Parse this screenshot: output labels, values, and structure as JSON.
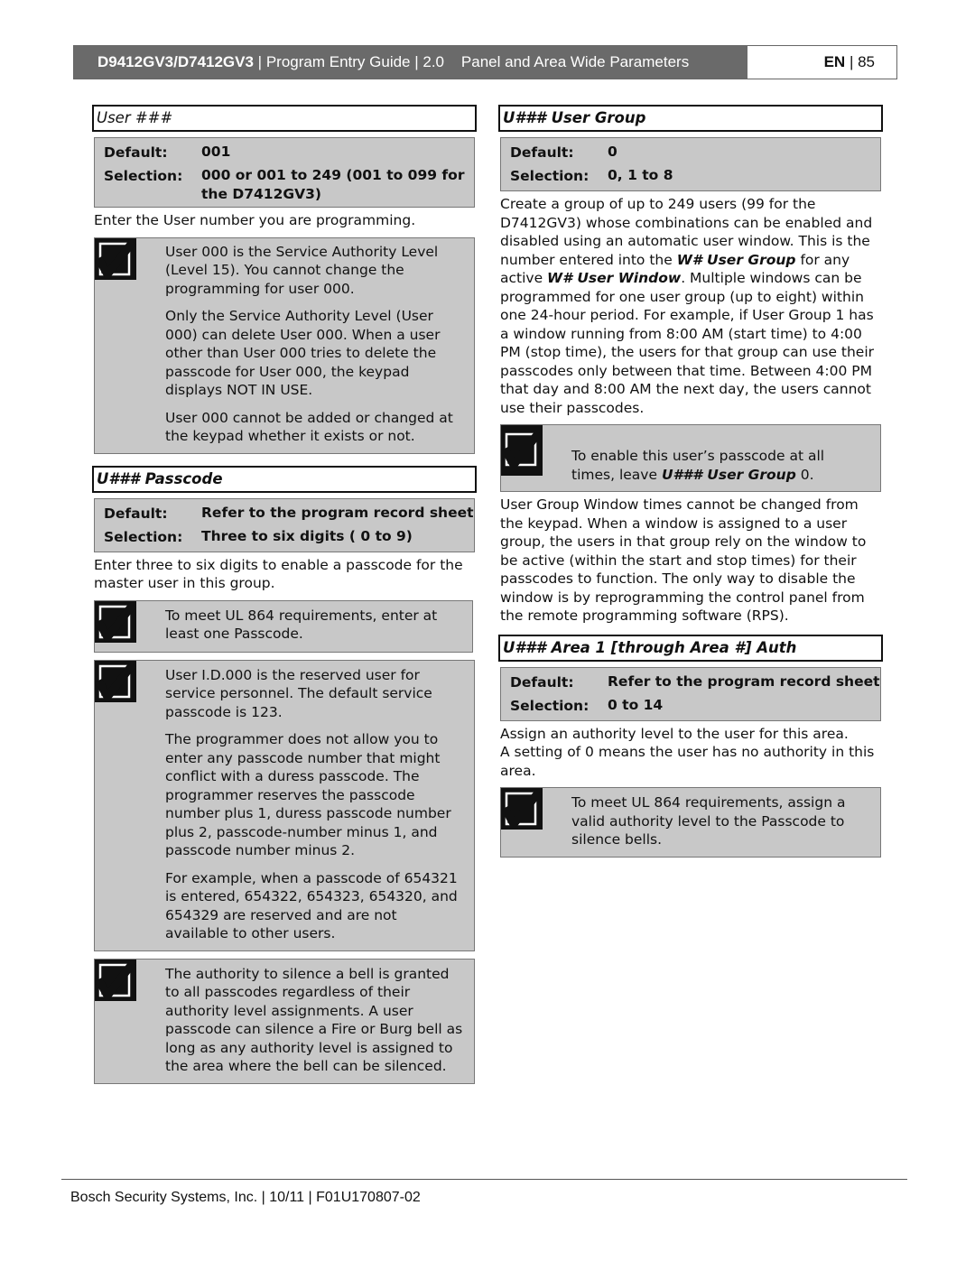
{
  "header": {
    "model": "D9412GV3/D7412GV3",
    "sep1": " | ",
    "guide": "Program Entry Guide | 2.0",
    "section": "Panel and Area Wide Parameters",
    "lang": "EN",
    "page": " | 85"
  },
  "left": {
    "user": {
      "title": "User ###",
      "default_label": "Default:",
      "default_value": "001",
      "selection_label": "Selection:",
      "selection_value": "000 or 001 to 249 (001 to 099 for the D7412GV3)",
      "description": "Enter the User number you are programming.",
      "note": [
        "User 000 is the Service Authority Level (Level 15). You cannot change the programming for user 000.",
        "Only the Service Authority Level (User 000) can delete User 000. When a user other than User 000 tries to delete the passcode for User 000, the keypad displays NOT IN USE.",
        "User 000 cannot be added or changed at the keypad whether it exists or not."
      ]
    },
    "passcode": {
      "title": "U### Passcode",
      "default_label": "Default:",
      "default_value": "Refer to the program record sheet",
      "selection_label": "Selection:",
      "selection_value": "Three to six digits ( 0 to 9)",
      "description": "Enter three to six digits to enable a passcode for the master user in this group.",
      "note1": "To meet UL 864 requirements, enter at least one Passcode.",
      "note2": [
        "User I.D.000 is the reserved user for service personnel. The default service passcode is 123.",
        "The programmer does not allow you to enter any passcode number that might conflict with a duress passcode. The programmer reserves the passcode number plus 1, duress passcode number plus 2, passcode-number minus 1, and passcode number minus 2.",
        "For example, when a passcode of 654321 is entered, 654322, 654323, 654320, and 654329 are reserved and are not available to other users."
      ],
      "note3": "The authority to silence a bell is granted to all passcodes regardless of their authority level assignments. A user passcode can silence a Fire or Burg bell as long as any authority level is assigned to the area where the bell can be silenced."
    }
  },
  "right": {
    "group": {
      "title": "U### User Group",
      "default_label": "Default:",
      "default_value": "0",
      "selection_label": "Selection:",
      "selection_value": "0, 1 to 8",
      "description_parts": [
        "Create a group of up to 249 users (99 for the D7412GV3) whose combinations can be enabled and disabled using an automatic user window. This is the number entered into the ",
        "W# User Group",
        " for any active ",
        "W# User Window",
        ". Multiple windows can be programmed for one user group (up to eight) within one 24-hour period. For example, if User Group 1 has a window running from 8:00 AM (start time) to 4:00 PM (stop time), the users for that group can use their passcodes only between that time. Between 4:00 PM that day and 8:00 AM the next day, the users cannot use their passcodes."
      ],
      "note_parts": [
        "To enable this user’s passcode at all times, leave ",
        "U### User Group",
        " 0."
      ],
      "description2": "User Group Window times cannot be changed from the keypad. When a window is assigned to a user group, the users in that group rely on the window to be active (within the start and stop times) for their passcodes to function. The only way to disable the window is by reprogramming the control panel from the remote programming software (RPS)."
    },
    "area": {
      "title": "U### Area 1 [through Area #] Auth",
      "default_label": "Default:",
      "default_value": "Refer to the program record sheet",
      "selection_label": "Selection:",
      "selection_value": "0 to 14",
      "description": "Assign an authority level to the user for this area.",
      "description2": "A setting of 0 means the user has no authority in this area.",
      "note": "To meet UL 864 requirements, assign a valid authority level to the Passcode to silence bells."
    }
  },
  "footer": "Bosch Security Systems, Inc. | 10/11 | F01U170807-02"
}
